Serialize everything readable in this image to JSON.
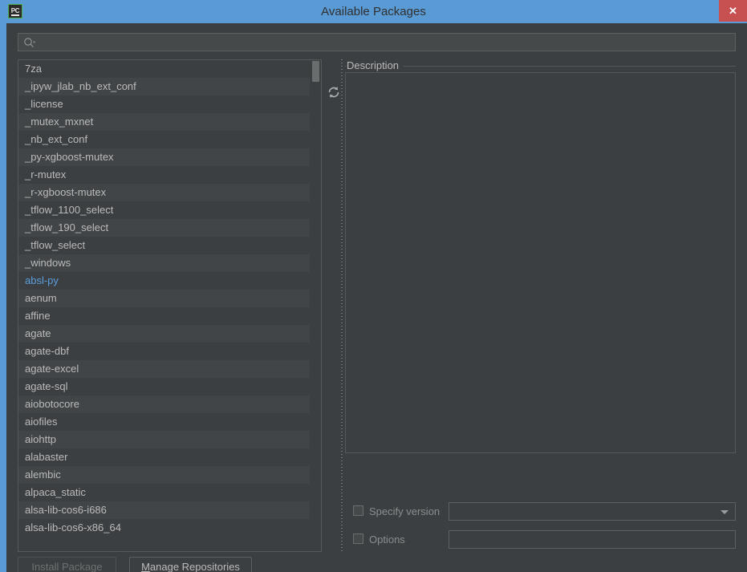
{
  "window": {
    "title": "Available Packages",
    "app_icon": "pycharm-icon",
    "icon_text": "PC",
    "close_label": "✕",
    "title_bar_color": "#5b9bd5",
    "close_button_color": "#c75050",
    "background_color": "#3c3f41"
  },
  "search": {
    "icon": "search-icon",
    "value": "",
    "placeholder": ""
  },
  "toolbar": {
    "refresh_icon": "refresh-icon"
  },
  "package_list": {
    "selected": "absl-py",
    "link_color": "#5a9ddb",
    "items": [
      "7za",
      "_ipyw_jlab_nb_ext_conf",
      "_license",
      "_mutex_mxnet",
      "_nb_ext_conf",
      "_py-xgboost-mutex",
      "_r-mutex",
      "_r-xgboost-mutex",
      "_tflow_1100_select",
      "_tflow_190_select",
      "_tflow_select",
      "_windows",
      "absl-py",
      "aenum",
      "affine",
      "agate",
      "agate-dbf",
      "agate-excel",
      "agate-sql",
      "aiobotocore",
      "aiofiles",
      "aiohttp",
      "alabaster",
      "alembic",
      "alpaca_static",
      "alsa-lib-cos6-i686",
      "alsa-lib-cos6-x86_64"
    ]
  },
  "description": {
    "label": "Description",
    "content": ""
  },
  "version": {
    "label": "Specify version",
    "checked": false,
    "value": "",
    "placeholder": ""
  },
  "options": {
    "label": "Options",
    "checked": false,
    "value": "",
    "placeholder": ""
  },
  "buttons": {
    "install": "Install Package",
    "install_enabled": false,
    "manage_mnemonic": "M",
    "manage_rest": "anage Repositories"
  }
}
